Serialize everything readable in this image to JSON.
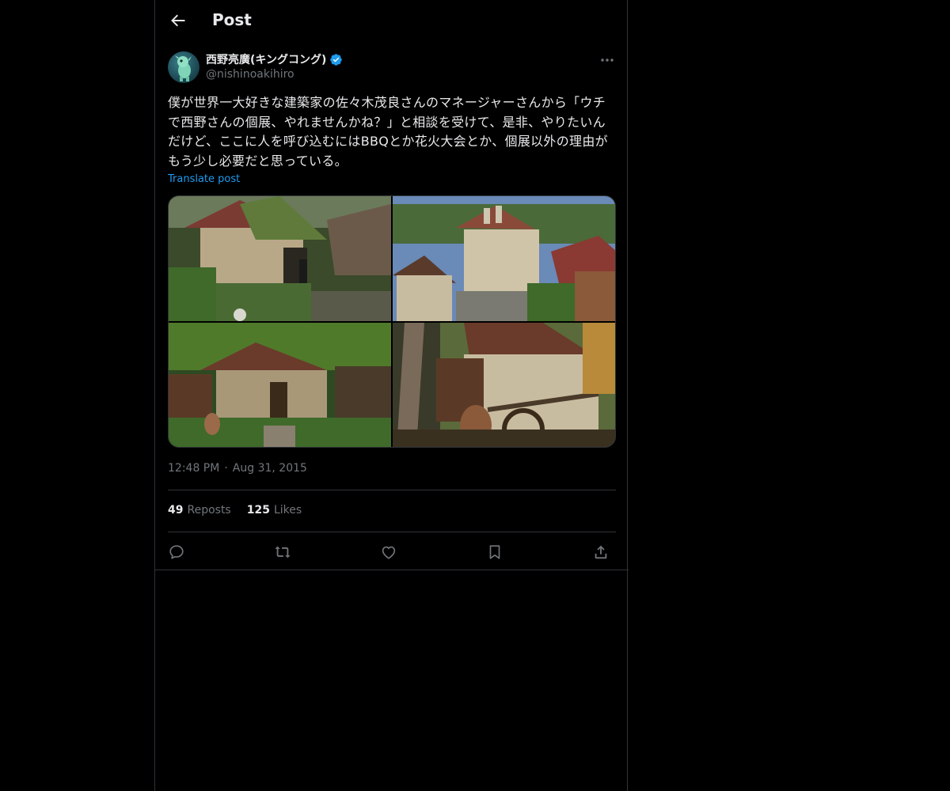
{
  "header": {
    "title": "Post"
  },
  "post": {
    "author": {
      "display_name": "西野亮廣(キングコング)",
      "handle": "@nishinoakihiro",
      "verified": true
    },
    "text": "僕が世界一大好きな建築家の佐々木茂良さんのマネージャーさんから「ウチで西野さんの個展、やれませんかね？」と相談を受けて、是非、やりたいんだけど、ここに人を呼び込むにはBBQとか花火大会とか、個展以外の理由がもう少し必要だと思っている。",
    "translate_label": "Translate post",
    "media_count": 4,
    "time": "12:48 PM",
    "separator": "·",
    "date": "Aug 31, 2015",
    "stats": {
      "reposts_count": "49",
      "reposts_label": "Reposts",
      "likes_count": "125",
      "likes_label": "Likes"
    }
  },
  "icons": {
    "back": "arrow-left-icon",
    "verified": "verified-badge-icon",
    "more": "more-horizontal-icon",
    "reply": "reply-icon",
    "repost": "repost-icon",
    "like": "heart-icon",
    "bookmark": "bookmark-icon",
    "share": "share-icon"
  },
  "colors": {
    "background": "#000000",
    "text": "#e7e9ea",
    "muted": "#71767b",
    "accent": "#1d9bf0",
    "border": "#2f3336"
  }
}
